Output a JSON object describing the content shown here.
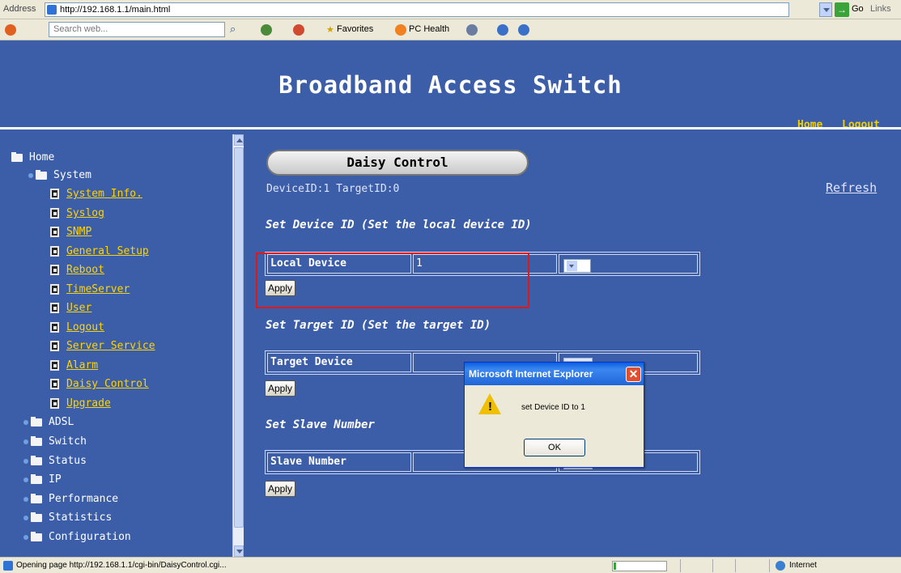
{
  "browser": {
    "address_label": "Address",
    "url": "http://192.168.1.1/main.html",
    "go_label": "Go",
    "links_label": "Links",
    "search_placeholder": "Search web...",
    "toolbar_items": [
      "Favorites",
      "PC Health"
    ]
  },
  "header": {
    "title": "Broadband Access Switch",
    "home_link": "Home",
    "logout_link": "Logout"
  },
  "sidebar": {
    "root": "Home",
    "system": "System",
    "system_items": [
      "System Info.",
      "Syslog",
      "SNMP",
      "General Setup",
      "Reboot",
      "TimeServer",
      "User",
      "Logout",
      "Server Service",
      "Alarm",
      "Daisy Control",
      "Upgrade"
    ],
    "groups": [
      "ADSL",
      "Switch",
      "Status",
      "IP",
      "Performance",
      "Statistics",
      "Configuration"
    ]
  },
  "main": {
    "section_title": "Daisy Control",
    "ids_text": "DeviceID:1 TargetID:0",
    "refresh": "Refresh",
    "set_device_title": "Set Device ID (Set the local device ID)",
    "local_device_label": "Local Device",
    "local_device_value": "1",
    "local_device_select": "0",
    "set_target_title": "Set Target ID (Set the target ID)",
    "target_device_label": "Target Device",
    "set_slave_title": "Set Slave Number",
    "slave_number_label": "Slave Number",
    "apply_label": "Apply"
  },
  "dialog": {
    "title": "Microsoft Internet Explorer",
    "message": "set Device ID to 1",
    "ok_label": "OK",
    "close_glyph": "✕",
    "icon": "warning-icon"
  },
  "status": {
    "text": "Opening page http://192.168.1.1/cgi-bin/DaisyControl.cgi...",
    "zone": "Internet",
    "progress": 0.05
  },
  "colors": {
    "background": "#3c5ea8",
    "link_yellow": "#ffd400",
    "highlight_red": "#e01818"
  }
}
